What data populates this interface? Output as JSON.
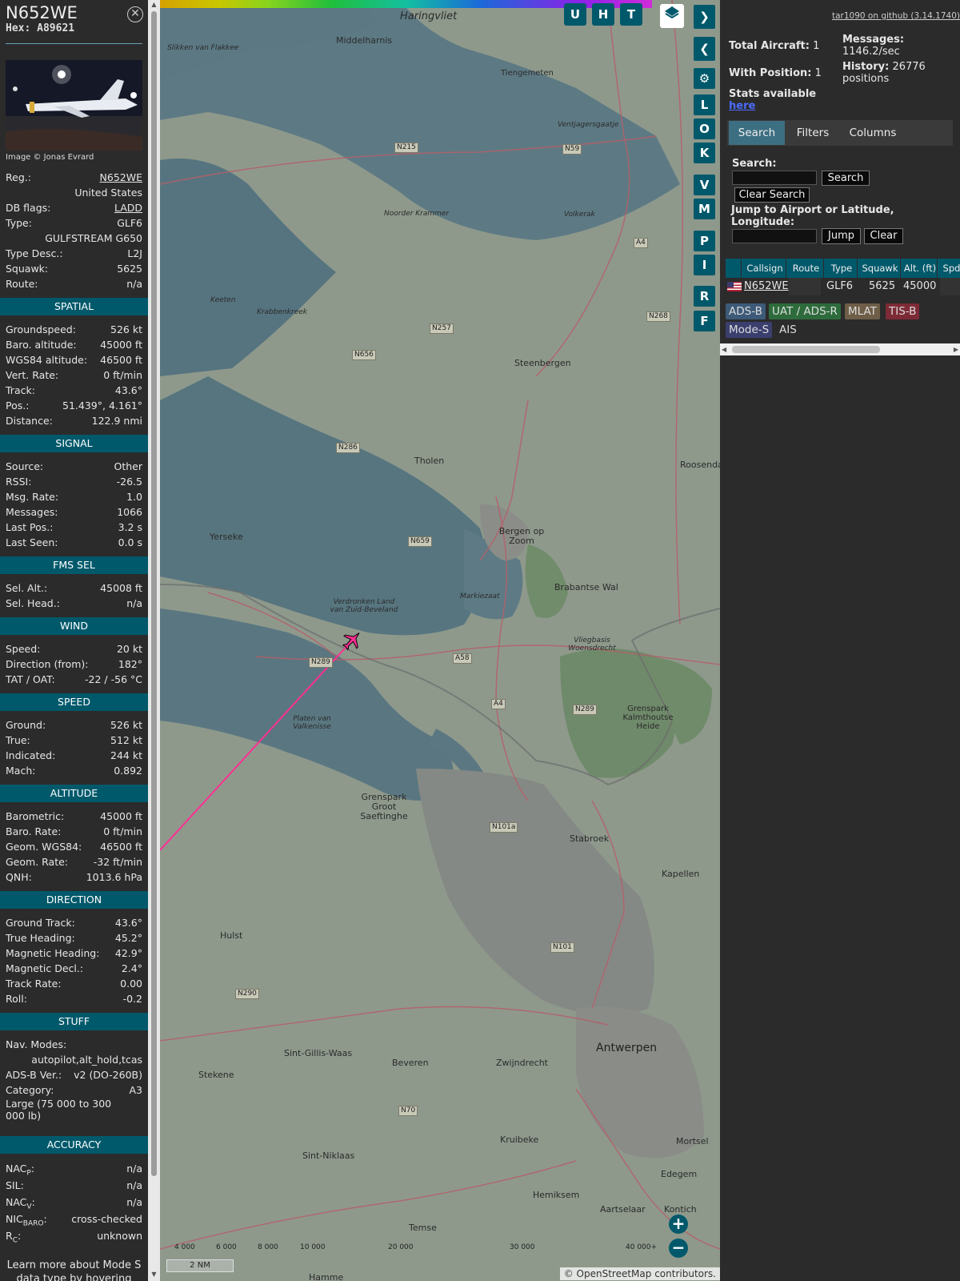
{
  "aircraft": {
    "callsign": "N652WE",
    "hex_label": "Hex:",
    "hex": "A89621",
    "image_credit": "Image © Jonas Evrard",
    "close_icon": "close-circle-icon",
    "top_rows": [
      {
        "label": "Reg.:",
        "value": "N652WE",
        "link": true
      },
      {
        "label": "",
        "value": "United States"
      },
      {
        "label": "DB flags:",
        "value": "LADD",
        "link": true
      },
      {
        "label": "Type:",
        "value": "GLF6"
      },
      {
        "label": "",
        "value": "GULFSTREAM G650"
      },
      {
        "label": "Type Desc.:",
        "value": "L2J"
      },
      {
        "label": "Squawk:",
        "value": "5625"
      },
      {
        "label": "Route:",
        "value": "n/a"
      }
    ],
    "sections": [
      {
        "title": "SPATIAL",
        "rows": [
          {
            "label": "Groundspeed:",
            "value": "526 kt"
          },
          {
            "label": "Baro. altitude:",
            "value": "45000 ft"
          },
          {
            "label": "WGS84 altitude:",
            "value": "46500 ft"
          },
          {
            "label": "Vert. Rate:",
            "value": "0 ft/min"
          },
          {
            "label": "Track:",
            "value": "43.6°"
          },
          {
            "label": "Pos.:",
            "value": "51.439°, 4.161°"
          },
          {
            "label": "Distance:",
            "value": "122.9 nmi"
          }
        ]
      },
      {
        "title": "SIGNAL",
        "rows": [
          {
            "label": "Source:",
            "value": "Other"
          },
          {
            "label": "RSSI:",
            "value": "-26.5"
          },
          {
            "label": "Msg. Rate:",
            "value": "1.0"
          },
          {
            "label": "Messages:",
            "value": "1066"
          },
          {
            "label": "Last Pos.:",
            "value": "3.2 s"
          },
          {
            "label": "Last Seen:",
            "value": "0.0 s"
          }
        ]
      },
      {
        "title": "FMS SEL",
        "rows": [
          {
            "label": "Sel. Alt.:",
            "value": "45008 ft"
          },
          {
            "label": "Sel. Head.:",
            "value": "n/a"
          }
        ]
      },
      {
        "title": "WIND",
        "rows": [
          {
            "label": "Speed:",
            "value": "20 kt"
          },
          {
            "label": "Direction (from):",
            "value": "182°"
          },
          {
            "label": "TAT / OAT:",
            "value": "-22 / -56 °C"
          }
        ]
      },
      {
        "title": "SPEED",
        "rows": [
          {
            "label": "Ground:",
            "value": "526 kt"
          },
          {
            "label": "True:",
            "value": "512 kt"
          },
          {
            "label": "Indicated:",
            "value": "244 kt"
          },
          {
            "label": "Mach:",
            "value": "0.892"
          }
        ]
      },
      {
        "title": "ALTITUDE",
        "rows": [
          {
            "label": "Barometric:",
            "value": "45000 ft"
          },
          {
            "label": "Baro. Rate:",
            "value": "0 ft/min"
          },
          {
            "label": "Geom. WGS84:",
            "value": "46500 ft"
          },
          {
            "label": "Geom. Rate:",
            "value": "-32 ft/min"
          },
          {
            "label": "QNH:",
            "value": "1013.6 hPa"
          }
        ]
      },
      {
        "title": "DIRECTION",
        "rows": [
          {
            "label": "Ground Track:",
            "value": "43.6°"
          },
          {
            "label": "True Heading:",
            "value": "45.2°"
          },
          {
            "label": "Magnetic Heading:",
            "value": "42.9°"
          },
          {
            "label": "Magnetic Decl.:",
            "value": "2.4°"
          },
          {
            "label": "Track Rate:",
            "value": "0.00"
          },
          {
            "label": "Roll:",
            "value": "-0.2"
          }
        ]
      }
    ],
    "stuff": {
      "title": "STUFF",
      "nav_modes_label": "Nav. Modes:",
      "nav_modes": "autopilot,alt_hold,tcas",
      "adsb_label": "ADS-B Ver.:",
      "adsb": "v2 (DO-260B)",
      "category_label": "Category:",
      "category": "A3",
      "category_desc": "Large (75 000 to 300 000 lb)"
    },
    "accuracy": {
      "title": "ACCURACY",
      "rows": [
        {
          "label": "NAC",
          "sub": "P",
          "value": "n/a"
        },
        {
          "label": "SIL:",
          "sub": "",
          "value": "n/a"
        },
        {
          "label": "NAC",
          "sub": "V",
          "value": "n/a"
        },
        {
          "label": "NIC",
          "sub": "BARO",
          "value": "cross-checked"
        },
        {
          "label": "R",
          "sub": "C",
          "value": "unknown"
        }
      ],
      "footer": "Learn more about Mode S data type by hovering over each data label"
    }
  },
  "map": {
    "top_buttons": [
      "U",
      "H",
      "T"
    ],
    "side_buttons": [
      "L",
      "O",
      "K",
      "V",
      "M",
      "P",
      "I",
      "R",
      "F"
    ],
    "scale": "2 NM",
    "attribution_prefix": "© ",
    "attribution_link": "OpenStreetMap",
    "attribution_suffix": " contributors.",
    "legend_ticks": [
      "4 000",
      "6 000",
      "8 000",
      "10 000",
      "20 000",
      "30 000",
      "40 000+"
    ],
    "labels": [
      "Haringvliet",
      "Middelharnis",
      "Tiengemeten",
      "Ventjagersgaatje",
      "Keeten",
      "Steenbergen",
      "Tholen",
      "Bergen op Zoom",
      "Yerseke",
      "Brabantse Wal",
      "Vliegbasis Woensdrecht",
      "Grenspark Kalmthoutse Heide",
      "Grenspark Groot Saeftinghe",
      "Stabroek",
      "Kapellen",
      "Hulst",
      "Antwerpen",
      "Sint-Gillis-Waas",
      "Beveren",
      "Zwijndrecht",
      "Stekene",
      "Kruibeke",
      "Sint-Niklaas",
      "Hemiksem",
      "Temse",
      "Aartselaar",
      "Kontich",
      "Edegem",
      "Mortsel",
      "Roosendaal",
      "Hamme",
      "Verdronken Land van Zuid-Beveland",
      "Platen van Valkenisse",
      "Markiezaat",
      "Slikken van Flakkee",
      "Noorder Krammer",
      "Volkerak",
      "Krabbenkreek"
    ],
    "road_labels": [
      "N215",
      "N59",
      "N257",
      "N656",
      "N286",
      "N659",
      "N289",
      "A58",
      "A4",
      "N289",
      "N101a",
      "N101",
      "N290",
      "N70",
      "N268",
      "A4"
    ]
  },
  "panel": {
    "github": "tar1090 on github (3.14.1740)",
    "total_aircraft_label": "Total Aircraft:",
    "total_aircraft": "1",
    "with_position_label": "With Position:",
    "with_position": "1",
    "messages_label": "Messages:",
    "messages": "1146.2/sec",
    "history_label": "History:",
    "history": "26776 positions",
    "stats": "Stats available",
    "stats_link": "here",
    "tabs": [
      "Search",
      "Filters",
      "Columns"
    ],
    "search_label": "Search:",
    "search_btn": "Search",
    "clear_search_btn": "Clear Search",
    "jump_label": "Jump to Airport or Latitude, Longitude:",
    "jump_btn": "Jump",
    "clear_btn": "Clear",
    "table_headers": [
      "",
      "Callsign",
      "Route",
      "Type",
      "Squawk",
      "Alt. (ft)",
      "Spd"
    ],
    "table_row": {
      "callsign": "N652WE",
      "route": "",
      "type": "GLF6",
      "squawk": "5625",
      "alt": "45000"
    },
    "sources": [
      "ADS-B",
      "UAT / ADS-R",
      "MLAT",
      "TIS-B",
      "Mode-S",
      "AIS"
    ]
  }
}
